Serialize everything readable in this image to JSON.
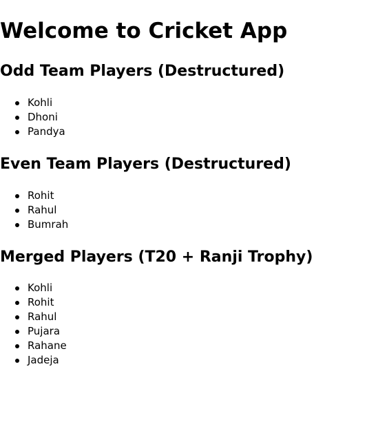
{
  "page": {
    "title": "Welcome to Cricket App"
  },
  "sections": {
    "odd": {
      "heading": "Odd Team Players (Destructured)",
      "players": [
        "Kohli",
        "Dhoni",
        "Pandya"
      ]
    },
    "even": {
      "heading": "Even Team Players (Destructured)",
      "players": [
        "Rohit",
        "Rahul",
        "Bumrah"
      ]
    },
    "merged": {
      "heading": "Merged Players (T20 + Ranji Trophy)",
      "players": [
        "Kohli",
        "Rohit",
        "Rahul",
        "Pujara",
        "Rahane",
        "Jadeja"
      ]
    }
  }
}
